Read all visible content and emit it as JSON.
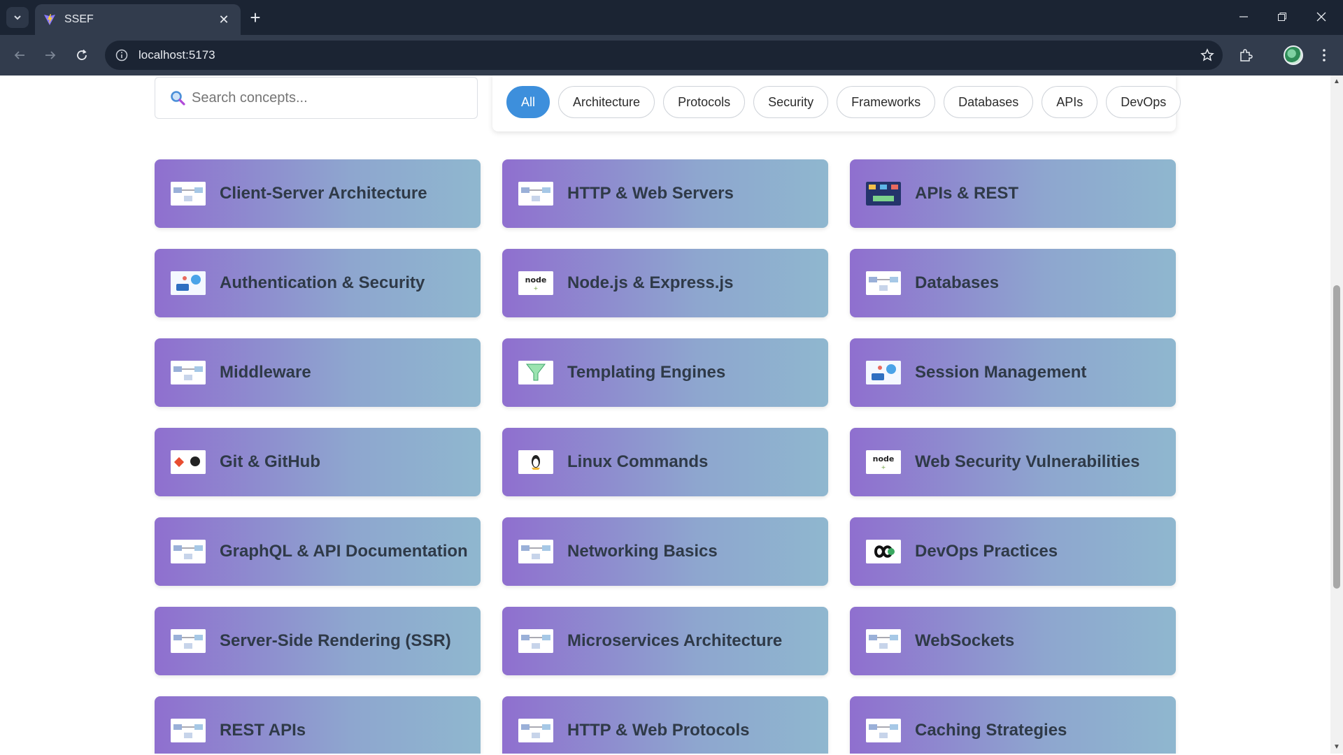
{
  "browser": {
    "tab_title": "SSEF",
    "url": "localhost:5173",
    "icons": {
      "tab_list": "chevron-down-icon",
      "favicon": "vite-logo-icon",
      "close": "close-icon",
      "new_tab": "plus-icon",
      "back": "back-arrow-icon",
      "forward": "forward-arrow-icon",
      "reload": "reload-icon",
      "site_info": "info-icon",
      "bookmark": "star-icon",
      "extensions": "puzzle-icon",
      "menu": "more-vertical-icon"
    }
  },
  "search": {
    "placeholder": "Search concepts..."
  },
  "filters": [
    {
      "label": "All",
      "active": true
    },
    {
      "label": "Architecture",
      "active": false
    },
    {
      "label": "Protocols",
      "active": false
    },
    {
      "label": "Security",
      "active": false
    },
    {
      "label": "Frameworks",
      "active": false
    },
    {
      "label": "Databases",
      "active": false
    },
    {
      "label": "APIs",
      "active": false
    },
    {
      "label": "DevOps",
      "active": false
    }
  ],
  "cards": [
    {
      "title": "Client-Server Architecture",
      "thumb": "diagram"
    },
    {
      "title": "HTTP & Web Servers",
      "thumb": "diagram"
    },
    {
      "title": "APIs & REST",
      "thumb": "dark"
    },
    {
      "title": "Authentication & Security",
      "thumb": "illustration"
    },
    {
      "title": "Node.js & Express.js",
      "thumb": "node"
    },
    {
      "title": "Databases",
      "thumb": "diagram"
    },
    {
      "title": "Middleware",
      "thumb": "diagram"
    },
    {
      "title": "Templating Engines",
      "thumb": "funnel"
    },
    {
      "title": "Session Management",
      "thumb": "illustration"
    },
    {
      "title": "Git & GitHub",
      "thumb": "logos"
    },
    {
      "title": "Linux Commands",
      "thumb": "linux"
    },
    {
      "title": "Web Security Vulnerabilities",
      "thumb": "node"
    },
    {
      "title": "GraphQL & API Documentation",
      "thumb": "diagram"
    },
    {
      "title": "Networking Basics",
      "thumb": "diagram"
    },
    {
      "title": "DevOps Practices",
      "thumb": "infinity"
    },
    {
      "title": "Server-Side Rendering (SSR)",
      "thumb": "diagram"
    },
    {
      "title": "Microservices Architecture",
      "thumb": "diagram"
    },
    {
      "title": "WebSockets",
      "thumb": "diagram"
    },
    {
      "title": "REST APIs",
      "thumb": "diagram"
    },
    {
      "title": "HTTP & Web Protocols",
      "thumb": "diagram"
    },
    {
      "title": "Caching Strategies",
      "thumb": "diagram"
    }
  ],
  "colors": {
    "chrome_dark": "#1b2433",
    "chrome_mid": "#323c4d",
    "chip_active": "#3d8fdc",
    "card_gradient_start": "#8f6fcf",
    "card_gradient_end": "#8fb7cf",
    "card_text": "#2f3a48"
  }
}
